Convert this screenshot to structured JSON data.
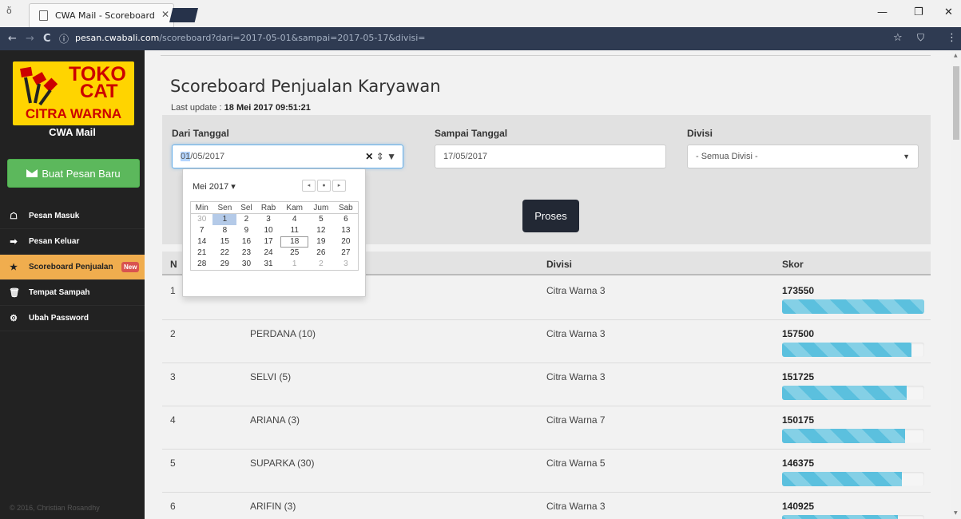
{
  "browser": {
    "tab_title": "CWA Mail - Scoreboard P",
    "tab_close": "✕",
    "url_host": "pesan.cwabali.com",
    "url_path": "/scoreboard?dari=2017-05-01&sampai=2017-05-17&divisi=",
    "icons": {
      "back": "←",
      "forward": "→",
      "reload": "C",
      "info": "ⓘ",
      "star": "☆",
      "shield": "⛉",
      "menu": "⋮",
      "minimize": "—",
      "maximize": "❐",
      "close": "✕",
      "profile": "ὄ"
    }
  },
  "sidebar": {
    "logo": {
      "line1": "TOKO",
      "line2": "CAT",
      "line3": "CITRA WARNA"
    },
    "app_name": "CWA Mail",
    "compose_label": "Buat Pesan Baru",
    "items": [
      {
        "label": "Pesan Masuk",
        "icon": "☖",
        "icon_name": "inbox-icon",
        "active": false
      },
      {
        "label": "Pesan Keluar",
        "icon": "➡",
        "icon_name": "outbox-icon",
        "active": false
      },
      {
        "label": "Scoreboard Penjualan",
        "icon": "★",
        "icon_name": "star-icon",
        "active": true,
        "badge": "New"
      },
      {
        "label": "Tempat Sampah",
        "icon": "🗑",
        "icon_name": "trash-icon",
        "active": false
      },
      {
        "label": "Ubah Password",
        "icon": "⚙",
        "icon_name": "gear-icon",
        "active": false
      }
    ],
    "footer": "© 2016, Christian Rosandhy"
  },
  "main": {
    "title": "Scoreboard Penjualan Karyawan",
    "last_update_label": "Last update :",
    "last_update_value": "18 Mei 2017 09:51:21",
    "filter": {
      "from_label": "Dari Tanggal",
      "from_value_selected": "01",
      "from_value_rest": "/05/2017",
      "to_label": "Sampai Tanggal",
      "to_value": "17/05/2017",
      "division_label": "Divisi",
      "division_value": "- Semua Divisi -",
      "submit_label": "Proses"
    },
    "table": {
      "columns": [
        "N",
        "Divisi",
        "Skor"
      ],
      "rows": [
        {
          "no": "1",
          "name": "",
          "division": "Citra Warna 3",
          "score": "173550",
          "pct": 100
        },
        {
          "no": "2",
          "name": "PERDANA (10)",
          "division": "Citra Warna 3",
          "score": "157500",
          "pct": 90.8
        },
        {
          "no": "3",
          "name": "SELVI (5)",
          "division": "Citra Warna 3",
          "score": "151725",
          "pct": 87.4
        },
        {
          "no": "4",
          "name": "ARIANA (3)",
          "division": "Citra Warna 7",
          "score": "150175",
          "pct": 86.5
        },
        {
          "no": "5",
          "name": "SUPARKA (30)",
          "division": "Citra Warna 5",
          "score": "146375",
          "pct": 84.3
        },
        {
          "no": "6",
          "name": "ARIFIN (3)",
          "division": "Citra Warna 3",
          "score": "140925",
          "pct": 81.2
        }
      ]
    }
  },
  "datepicker": {
    "month_label": "Mei 2017 ▾",
    "buttons": [
      "◂",
      "●",
      "▸"
    ],
    "weekdays": [
      "Min",
      "Sen",
      "Sel",
      "Rab",
      "Kam",
      "Jum",
      "Sab"
    ],
    "weeks": [
      [
        "30",
        "1",
        "2",
        "3",
        "4",
        "5",
        "6"
      ],
      [
        "7",
        "8",
        "9",
        "10",
        "11",
        "12",
        "13"
      ],
      [
        "14",
        "15",
        "16",
        "17",
        "18",
        "19",
        "20"
      ],
      [
        "21",
        "22",
        "23",
        "24",
        "25",
        "26",
        "27"
      ],
      [
        "28",
        "29",
        "30",
        "31",
        "1",
        "2",
        "3"
      ]
    ],
    "selected": "1",
    "today": "18"
  },
  "colors": {
    "sidebar": "#222222",
    "active_nav": "#f0ad4e",
    "compose": "#5cb85c",
    "progress": "#5bc0de",
    "submit": "#222834"
  }
}
